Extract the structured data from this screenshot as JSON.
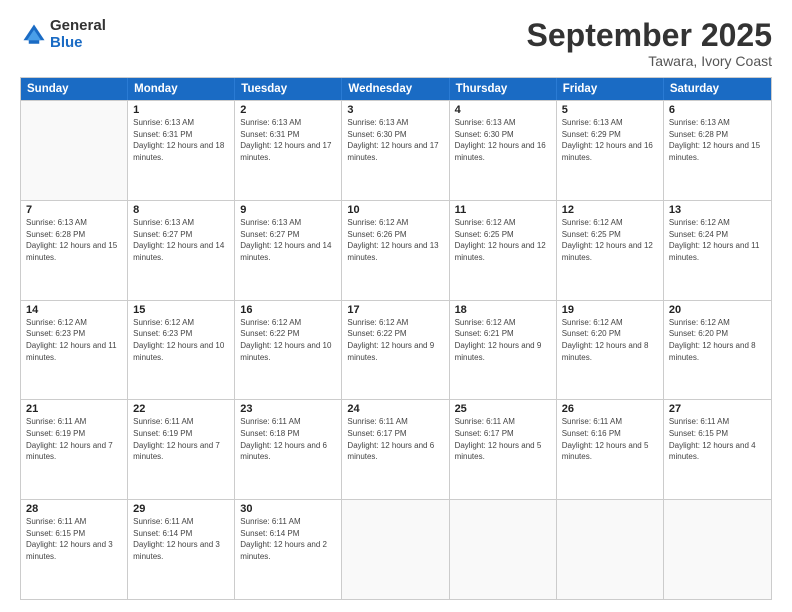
{
  "logo": {
    "general": "General",
    "blue": "Blue"
  },
  "header": {
    "title": "September 2025",
    "location": "Tawara, Ivory Coast"
  },
  "days": [
    "Sunday",
    "Monday",
    "Tuesday",
    "Wednesday",
    "Thursday",
    "Friday",
    "Saturday"
  ],
  "weeks": [
    [
      {
        "day": "",
        "sunrise": "",
        "sunset": "",
        "daylight": ""
      },
      {
        "day": "1",
        "sunrise": "Sunrise: 6:13 AM",
        "sunset": "Sunset: 6:31 PM",
        "daylight": "Daylight: 12 hours and 18 minutes."
      },
      {
        "day": "2",
        "sunrise": "Sunrise: 6:13 AM",
        "sunset": "Sunset: 6:31 PM",
        "daylight": "Daylight: 12 hours and 17 minutes."
      },
      {
        "day": "3",
        "sunrise": "Sunrise: 6:13 AM",
        "sunset": "Sunset: 6:30 PM",
        "daylight": "Daylight: 12 hours and 17 minutes."
      },
      {
        "day": "4",
        "sunrise": "Sunrise: 6:13 AM",
        "sunset": "Sunset: 6:30 PM",
        "daylight": "Daylight: 12 hours and 16 minutes."
      },
      {
        "day": "5",
        "sunrise": "Sunrise: 6:13 AM",
        "sunset": "Sunset: 6:29 PM",
        "daylight": "Daylight: 12 hours and 16 minutes."
      },
      {
        "day": "6",
        "sunrise": "Sunrise: 6:13 AM",
        "sunset": "Sunset: 6:28 PM",
        "daylight": "Daylight: 12 hours and 15 minutes."
      }
    ],
    [
      {
        "day": "7",
        "sunrise": "Sunrise: 6:13 AM",
        "sunset": "Sunset: 6:28 PM",
        "daylight": "Daylight: 12 hours and 15 minutes."
      },
      {
        "day": "8",
        "sunrise": "Sunrise: 6:13 AM",
        "sunset": "Sunset: 6:27 PM",
        "daylight": "Daylight: 12 hours and 14 minutes."
      },
      {
        "day": "9",
        "sunrise": "Sunrise: 6:13 AM",
        "sunset": "Sunset: 6:27 PM",
        "daylight": "Daylight: 12 hours and 14 minutes."
      },
      {
        "day": "10",
        "sunrise": "Sunrise: 6:12 AM",
        "sunset": "Sunset: 6:26 PM",
        "daylight": "Daylight: 12 hours and 13 minutes."
      },
      {
        "day": "11",
        "sunrise": "Sunrise: 6:12 AM",
        "sunset": "Sunset: 6:25 PM",
        "daylight": "Daylight: 12 hours and 12 minutes."
      },
      {
        "day": "12",
        "sunrise": "Sunrise: 6:12 AM",
        "sunset": "Sunset: 6:25 PM",
        "daylight": "Daylight: 12 hours and 12 minutes."
      },
      {
        "day": "13",
        "sunrise": "Sunrise: 6:12 AM",
        "sunset": "Sunset: 6:24 PM",
        "daylight": "Daylight: 12 hours and 11 minutes."
      }
    ],
    [
      {
        "day": "14",
        "sunrise": "Sunrise: 6:12 AM",
        "sunset": "Sunset: 6:23 PM",
        "daylight": "Daylight: 12 hours and 11 minutes."
      },
      {
        "day": "15",
        "sunrise": "Sunrise: 6:12 AM",
        "sunset": "Sunset: 6:23 PM",
        "daylight": "Daylight: 12 hours and 10 minutes."
      },
      {
        "day": "16",
        "sunrise": "Sunrise: 6:12 AM",
        "sunset": "Sunset: 6:22 PM",
        "daylight": "Daylight: 12 hours and 10 minutes."
      },
      {
        "day": "17",
        "sunrise": "Sunrise: 6:12 AM",
        "sunset": "Sunset: 6:22 PM",
        "daylight": "Daylight: 12 hours and 9 minutes."
      },
      {
        "day": "18",
        "sunrise": "Sunrise: 6:12 AM",
        "sunset": "Sunset: 6:21 PM",
        "daylight": "Daylight: 12 hours and 9 minutes."
      },
      {
        "day": "19",
        "sunrise": "Sunrise: 6:12 AM",
        "sunset": "Sunset: 6:20 PM",
        "daylight": "Daylight: 12 hours and 8 minutes."
      },
      {
        "day": "20",
        "sunrise": "Sunrise: 6:12 AM",
        "sunset": "Sunset: 6:20 PM",
        "daylight": "Daylight: 12 hours and 8 minutes."
      }
    ],
    [
      {
        "day": "21",
        "sunrise": "Sunrise: 6:11 AM",
        "sunset": "Sunset: 6:19 PM",
        "daylight": "Daylight: 12 hours and 7 minutes."
      },
      {
        "day": "22",
        "sunrise": "Sunrise: 6:11 AM",
        "sunset": "Sunset: 6:19 PM",
        "daylight": "Daylight: 12 hours and 7 minutes."
      },
      {
        "day": "23",
        "sunrise": "Sunrise: 6:11 AM",
        "sunset": "Sunset: 6:18 PM",
        "daylight": "Daylight: 12 hours and 6 minutes."
      },
      {
        "day": "24",
        "sunrise": "Sunrise: 6:11 AM",
        "sunset": "Sunset: 6:17 PM",
        "daylight": "Daylight: 12 hours and 6 minutes."
      },
      {
        "day": "25",
        "sunrise": "Sunrise: 6:11 AM",
        "sunset": "Sunset: 6:17 PM",
        "daylight": "Daylight: 12 hours and 5 minutes."
      },
      {
        "day": "26",
        "sunrise": "Sunrise: 6:11 AM",
        "sunset": "Sunset: 6:16 PM",
        "daylight": "Daylight: 12 hours and 5 minutes."
      },
      {
        "day": "27",
        "sunrise": "Sunrise: 6:11 AM",
        "sunset": "Sunset: 6:15 PM",
        "daylight": "Daylight: 12 hours and 4 minutes."
      }
    ],
    [
      {
        "day": "28",
        "sunrise": "Sunrise: 6:11 AM",
        "sunset": "Sunset: 6:15 PM",
        "daylight": "Daylight: 12 hours and 3 minutes."
      },
      {
        "day": "29",
        "sunrise": "Sunrise: 6:11 AM",
        "sunset": "Sunset: 6:14 PM",
        "daylight": "Daylight: 12 hours and 3 minutes."
      },
      {
        "day": "30",
        "sunrise": "Sunrise: 6:11 AM",
        "sunset": "Sunset: 6:14 PM",
        "daylight": "Daylight: 12 hours and 2 minutes."
      },
      {
        "day": "",
        "sunrise": "",
        "sunset": "",
        "daylight": ""
      },
      {
        "day": "",
        "sunrise": "",
        "sunset": "",
        "daylight": ""
      },
      {
        "day": "",
        "sunrise": "",
        "sunset": "",
        "daylight": ""
      },
      {
        "day": "",
        "sunrise": "",
        "sunset": "",
        "daylight": ""
      }
    ]
  ]
}
